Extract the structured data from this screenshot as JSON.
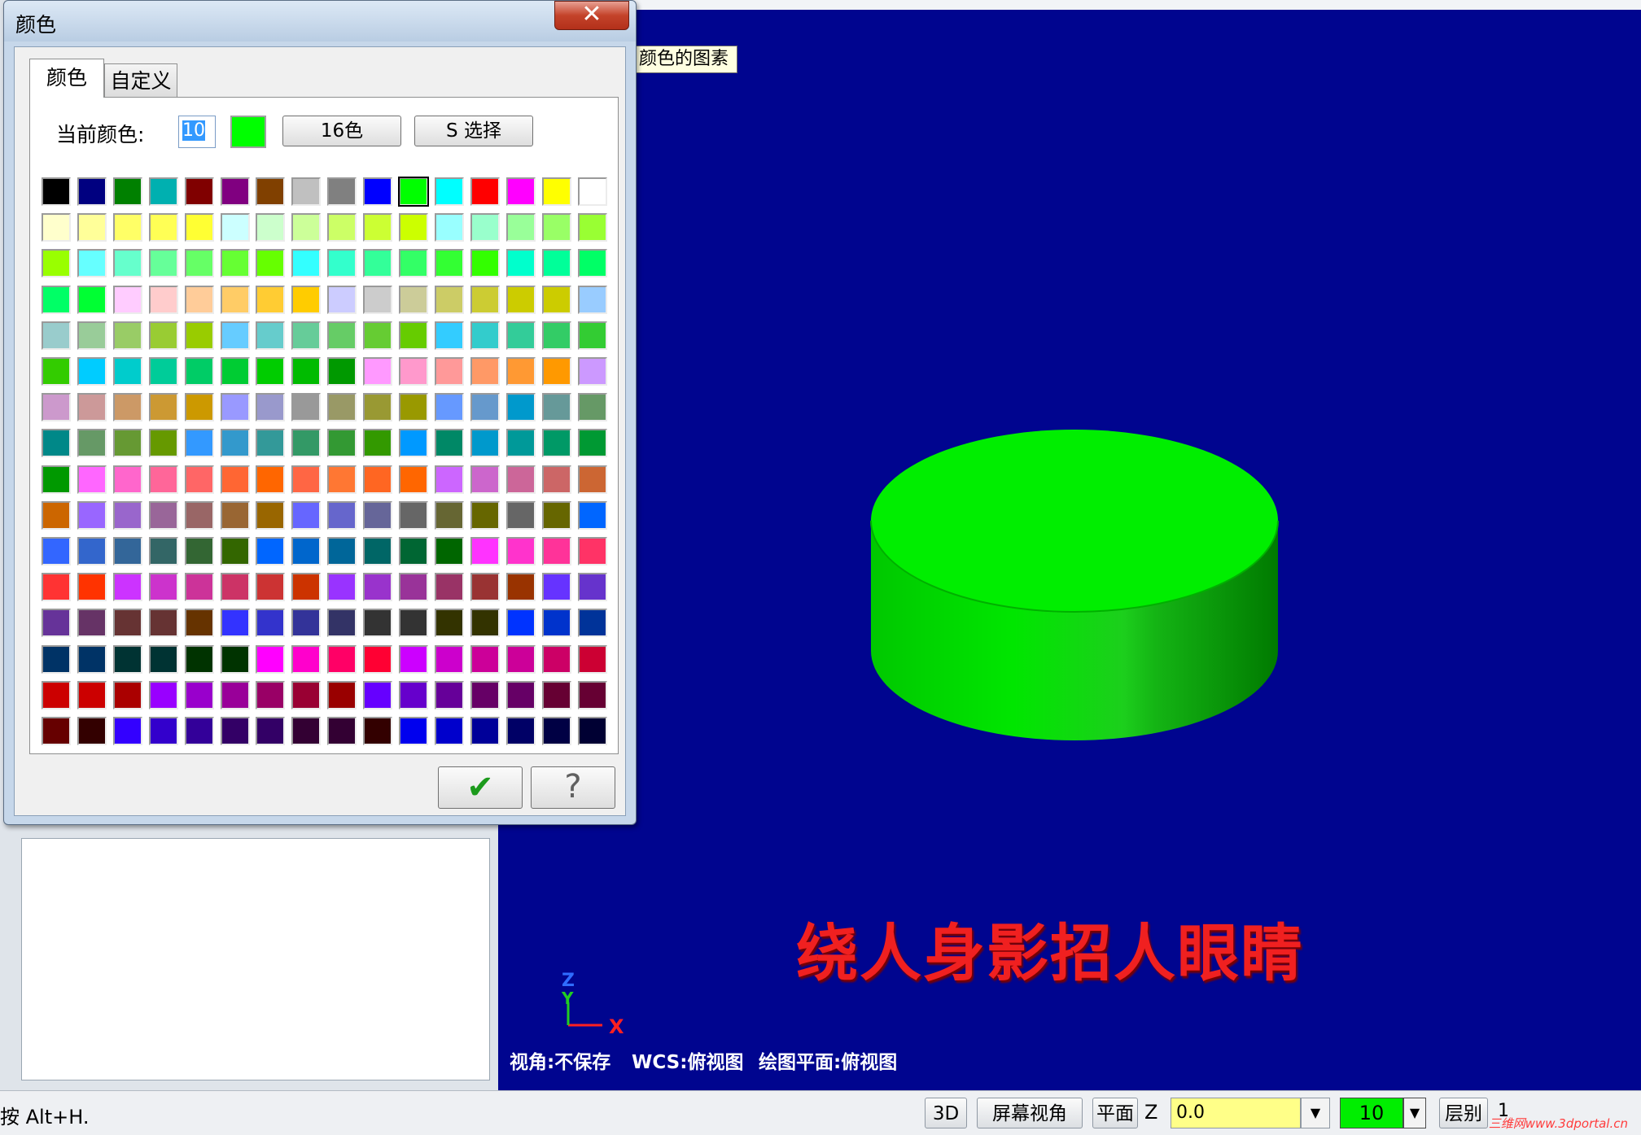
{
  "dialog": {
    "title": "颜色",
    "close_label": "✕",
    "tabs": [
      {
        "label": "颜色",
        "active": true
      },
      {
        "label": "自定义",
        "active": false
      }
    ],
    "current_color_label": "当前颜色:",
    "current_color_value": "10",
    "current_color_hex": "#00ff00",
    "btn_16color": "16色",
    "btn_select": "S 选择",
    "ok_glyph": "✔",
    "help_glyph": "?",
    "selected_index": 10,
    "swatches": [
      [
        "#000000",
        "#000080",
        "#008000",
        "#00b0b0",
        "#800000",
        "#800080",
        "#804000",
        "#c0c0c0",
        "#808080",
        "#0000ff",
        "#00ff00",
        "#00ffff",
        "#ff0000",
        "#ff00ff",
        "#ffff00",
        "#ffffff"
      ],
      [
        "#ffffcc",
        "#ffff99",
        "#ffff66",
        "#ffff55",
        "#ffff33",
        "#ccffff",
        "#ccffcc",
        "#ccff99",
        "#ccff66",
        "#ccff33",
        "#ccff00",
        "#99ffff",
        "#99ffcc",
        "#99ff99",
        "#99ff66",
        "#99ff33"
      ],
      [
        "#99ff00",
        "#66ffff",
        "#66ffcc",
        "#66ff99",
        "#66ff66",
        "#66ff33",
        "#66ff00",
        "#33ffff",
        "#33ffcc",
        "#33ff99",
        "#33ff66",
        "#33ff33",
        "#33ff00",
        "#00ffcc",
        "#00ff99",
        "#00ff66"
      ],
      [
        "#00ff66",
        "#00ff33",
        "#ffccff",
        "#ffcccc",
        "#ffcc99",
        "#ffcc66",
        "#ffcc33",
        "#ffcc00",
        "#ccccff",
        "#cccccc",
        "#cccc99",
        "#cccc66",
        "#cccc33",
        "#cccc00",
        "#cccc00",
        "#99ccff"
      ],
      [
        "#99cccc",
        "#99cc99",
        "#99cc66",
        "#99cc33",
        "#99cc00",
        "#66ccff",
        "#66cccc",
        "#66cc99",
        "#66cc66",
        "#66cc33",
        "#66cc00",
        "#33ccff",
        "#33cccc",
        "#33cc99",
        "#33cc66",
        "#33cc33"
      ],
      [
        "#33cc00",
        "#00ccff",
        "#00cccc",
        "#00cc99",
        "#00cc66",
        "#00cc33",
        "#00cc00",
        "#00bb00",
        "#009900",
        "#ff99ff",
        "#ff99cc",
        "#ff9999",
        "#ff9966",
        "#ff9933",
        "#ff9900",
        "#cc99ff"
      ],
      [
        "#cc99cc",
        "#cc9999",
        "#cc9966",
        "#cc9933",
        "#cc9900",
        "#9999ff",
        "#9999cc",
        "#999999",
        "#999966",
        "#999933",
        "#999900",
        "#6699ff",
        "#6699cc",
        "#0099cc",
        "#669999",
        "#669966"
      ],
      [
        "#008888",
        "#669966",
        "#669933",
        "#669900",
        "#3399ff",
        "#3399cc",
        "#339999",
        "#339966",
        "#339933",
        "#339900",
        "#0099ff",
        "#008866",
        "#0099cc",
        "#009999",
        "#009966",
        "#009933"
      ],
      [
        "#009900",
        "#ff66ff",
        "#ff66cc",
        "#ff6699",
        "#ff6666",
        "#ff6633",
        "#ff6600",
        "#ff6644",
        "#ff7733",
        "#ff6622",
        "#ff6600",
        "#cc66ff",
        "#cc66cc",
        "#cc6699",
        "#cc6666",
        "#cc6633"
      ],
      [
        "#cc6600",
        "#9966ff",
        "#9966cc",
        "#996699",
        "#996666",
        "#996633",
        "#996600",
        "#6666ff",
        "#6666cc",
        "#666699",
        "#666666",
        "#666633",
        "#666600",
        "#666666",
        "#666600",
        "#0066ff"
      ],
      [
        "#3366ff",
        "#3366cc",
        "#336699",
        "#336666",
        "#336633",
        "#336600",
        "#0066ff",
        "#0066cc",
        "#006699",
        "#006666",
        "#006633",
        "#006600",
        "#ff33ff",
        "#ff33cc",
        "#ff3399",
        "#ff3366"
      ],
      [
        "#ff3333",
        "#ff3300",
        "#cc33ff",
        "#cc33cc",
        "#cc3399",
        "#cc3366",
        "#cc3333",
        "#cc3300",
        "#9933ff",
        "#9933cc",
        "#993399",
        "#993366",
        "#993333",
        "#993300",
        "#6633ff",
        "#6633cc"
      ],
      [
        "#663399",
        "#663366",
        "#663333",
        "#663333",
        "#663300",
        "#3333ff",
        "#3333cc",
        "#333399",
        "#333366",
        "#333333",
        "#333333",
        "#333300",
        "#333300",
        "#0033ff",
        "#0033cc",
        "#003399"
      ],
      [
        "#003366",
        "#003366",
        "#003333",
        "#003333",
        "#003300",
        "#003300",
        "#ff00ff",
        "#ff00cc",
        "#ff0066",
        "#ff0033",
        "#cc00ff",
        "#cc00cc",
        "#cc0099",
        "#cc0099",
        "#cc0066",
        "#cc0033"
      ],
      [
        "#cc0000",
        "#cc0000",
        "#aa0000",
        "#9900ff",
        "#9900cc",
        "#990099",
        "#990066",
        "#990033",
        "#990000",
        "#6600ff",
        "#6600cc",
        "#660099",
        "#660066",
        "#660066",
        "#660033",
        "#660033"
      ],
      [
        "#660000",
        "#330000",
        "#3300ff",
        "#3300cc",
        "#330099",
        "#330066",
        "#330066",
        "#330033",
        "#330033",
        "#330000",
        "#0000ee",
        "#0000cc",
        "#000099",
        "#000066",
        "#000044",
        "#000033"
      ]
    ]
  },
  "viewport": {
    "tooltip": "颜色的图素",
    "overlay_text": "绕人身影招人眼睛",
    "info_view": "视角:不保存",
    "info_wcs": "WCS:俯视图",
    "info_plane": "绘图平面:俯视图",
    "axis_x": "X",
    "axis_y": "Y",
    "axis_z": "Z",
    "background_color": "#00058f",
    "object_color": "#00ee00",
    "watermark": "三维网www.3dportal.cn"
  },
  "statusbar": {
    "hint": "按 Alt+H.",
    "btn_3d": "3D",
    "btn_screen_view": "屏幕视角",
    "btn_plane": "平面",
    "z_label": "Z",
    "z_value": "0.0",
    "color_value": "10",
    "btn_layer": "层别",
    "layer_value": "1",
    "dropdown_glyph": "▼"
  }
}
